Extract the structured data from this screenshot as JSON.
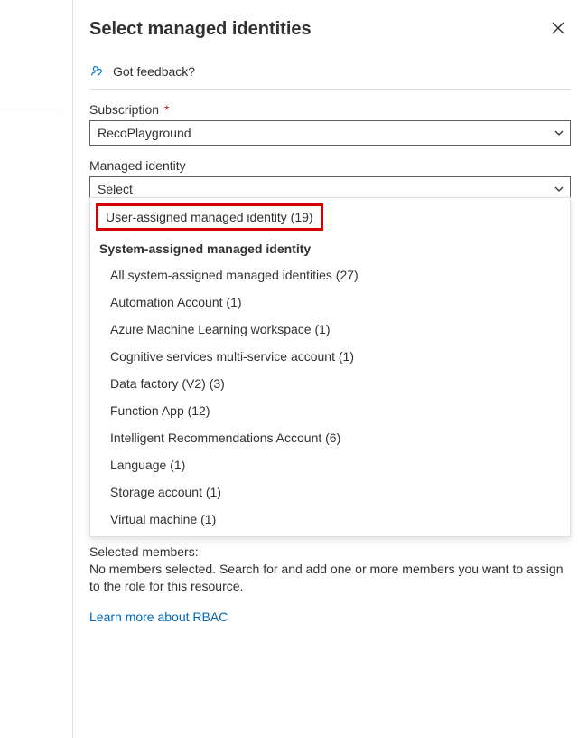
{
  "panel": {
    "title": "Select managed identities",
    "feedback": "Got feedback?"
  },
  "subscription": {
    "label": "Subscription",
    "required": "*",
    "value": "RecoPlayground"
  },
  "managed_identity": {
    "label": "Managed identity",
    "placeholder": "Select"
  },
  "dropdown": {
    "user_assigned": "User-assigned managed identity (19)",
    "system_header": "System-assigned managed identity",
    "items": [
      "All system-assigned managed identities (27)",
      "Automation Account (1)",
      "Azure Machine Learning workspace (1)",
      "Cognitive services multi-service account (1)",
      "Data factory (V2) (3)",
      "Function App (12)",
      "Intelligent Recommendations Account (6)",
      "Language (1)",
      "Storage account (1)",
      "Virtual machine (1)"
    ]
  },
  "selected": {
    "label": "Selected members:",
    "text": "No members selected. Search for and add one or more members you want to assign to the role for this resource."
  },
  "link": "Learn more about RBAC"
}
